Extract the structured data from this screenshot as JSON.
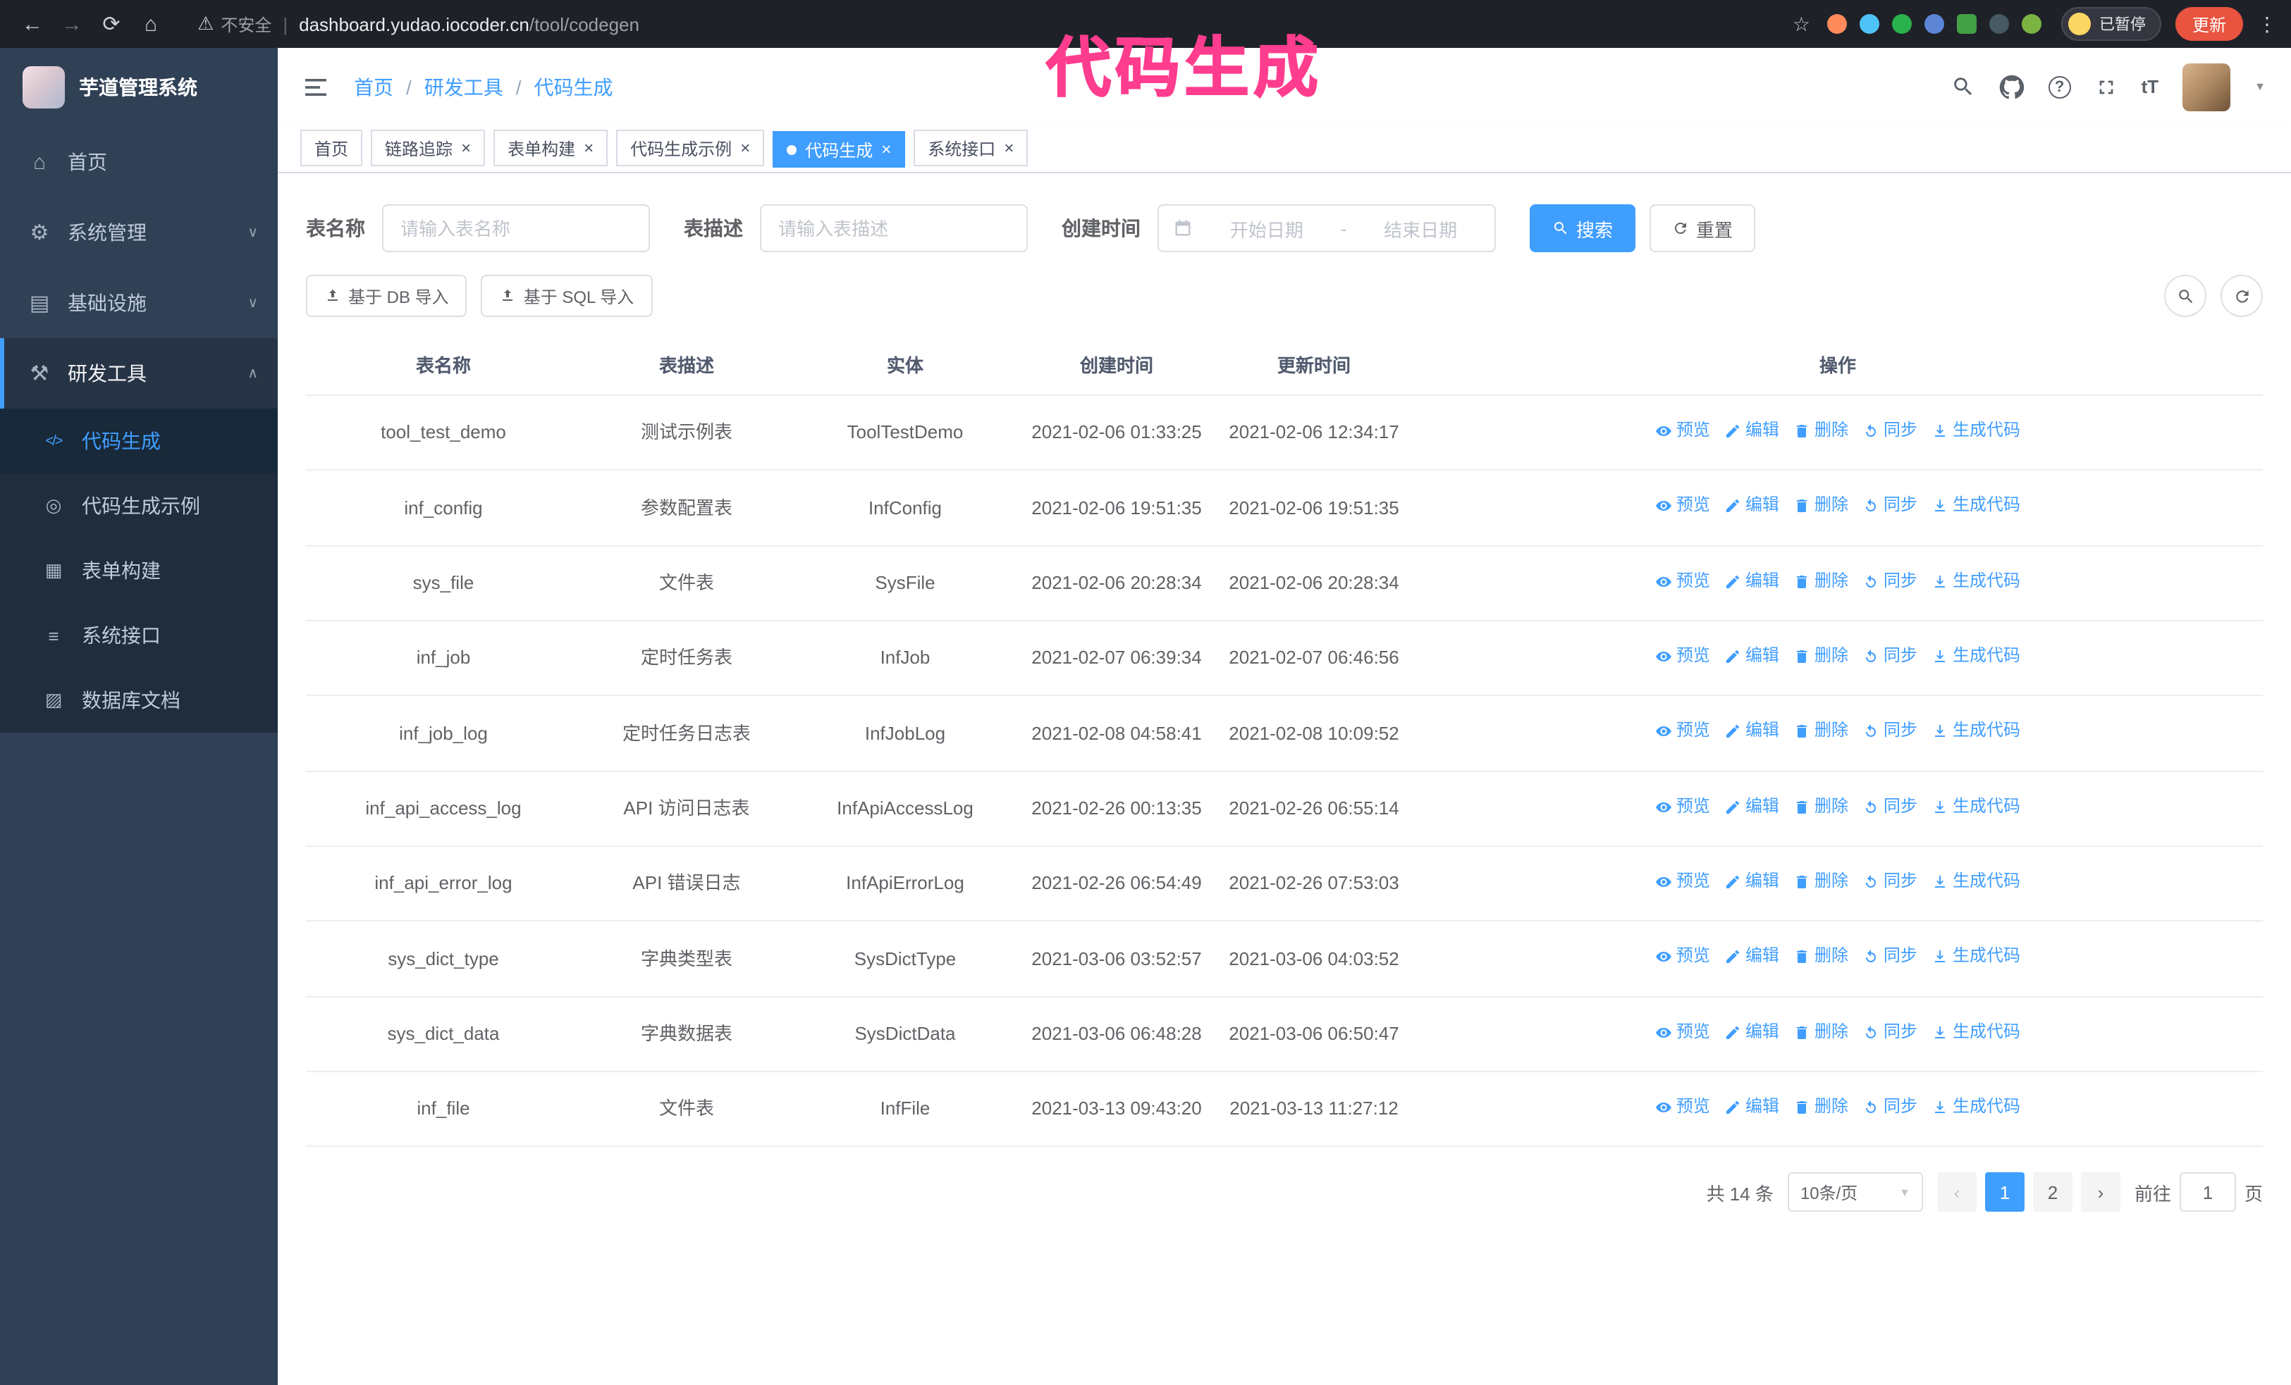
{
  "annotation": {
    "text": "代码生成",
    "color": "#ff3d8e"
  },
  "browser": {
    "security_text": "不安全",
    "url_host": "dashboard.yudao.iocoder.cn",
    "url_path": "/tool/codegen",
    "paused_label": "已暂停",
    "update_label": "更新",
    "extensions": [
      {
        "name": "extension-icon",
        "color": "#ff8a5c",
        "shape": "circle"
      },
      {
        "name": "extension-icon",
        "color": "#4fc3f7",
        "shape": "circle"
      },
      {
        "name": "extension-icon",
        "color": "#2bb24c",
        "shape": "circle"
      },
      {
        "name": "extension-icon",
        "color": "#5c85d6",
        "shape": "circle"
      },
      {
        "name": "extension-icon",
        "color": "#43a047",
        "shape": "square"
      },
      {
        "name": "extension-icon",
        "color": "#455a64",
        "shape": "circle"
      },
      {
        "name": "extension-icon",
        "color": "#7cb342",
        "shape": "circle"
      }
    ]
  },
  "sidebar": {
    "logo_title": "芋道管理系统",
    "items": [
      {
        "key": "home",
        "label": "首页",
        "icon": "home-icon"
      },
      {
        "key": "system",
        "label": "系统管理",
        "icon": "system-icon",
        "chevron": "down"
      },
      {
        "key": "infra",
        "label": "基础设施",
        "icon": "infra-icon",
        "chevron": "down"
      },
      {
        "key": "devtools",
        "label": "研发工具",
        "icon": "devtools-icon",
        "chevron": "up",
        "expanded": true
      }
    ],
    "sub_items": [
      {
        "key": "codegen",
        "label": "代码生成",
        "icon": "codegen-icon",
        "active": true
      },
      {
        "key": "codegen-example",
        "label": "代码生成示例",
        "icon": "example-icon"
      },
      {
        "key": "form-builder",
        "label": "表单构建",
        "icon": "form-icon"
      },
      {
        "key": "api",
        "label": "系统接口",
        "icon": "api-icon"
      },
      {
        "key": "db-doc",
        "label": "数据库文档",
        "icon": "dbdoc-icon"
      }
    ]
  },
  "header": {
    "breadcrumb": [
      "首页",
      "研发工具",
      "代码生成"
    ]
  },
  "tabs": [
    {
      "key": "home",
      "label": "首页",
      "closable": false
    },
    {
      "key": "tracing",
      "label": "链路追踪",
      "closable": true
    },
    {
      "key": "form-builder",
      "label": "表单构建",
      "closable": true
    },
    {
      "key": "codegen-example",
      "label": "代码生成示例",
      "closable": true
    },
    {
      "key": "codegen",
      "label": "代码生成",
      "closable": true,
      "active": true
    },
    {
      "key": "api",
      "label": "系统接口",
      "closable": true
    }
  ],
  "filters": {
    "table_name_label": "表名称",
    "table_name_placeholder": "请输入表名称",
    "table_desc_label": "表描述",
    "table_desc_placeholder": "请输入表描述",
    "create_time_label": "创建时间",
    "start_date_placeholder": "开始日期",
    "range_separator": "-",
    "end_date_placeholder": "结束日期",
    "search_label": "搜索",
    "reset_label": "重置"
  },
  "toolbar": {
    "import_db_label": "基于 DB 导入",
    "import_sql_label": "基于 SQL 导入"
  },
  "table": {
    "columns": [
      "表名称",
      "表描述",
      "实体",
      "创建时间",
      "更新时间",
      "操作"
    ],
    "actions": [
      "预览",
      "编辑",
      "删除",
      "同步",
      "生成代码"
    ],
    "rows": [
      {
        "name": "tool_test_demo",
        "desc": "测试示例表",
        "entity": "ToolTestDemo",
        "created": "2021-02-06 01:33:25",
        "updated": "2021-02-06 12:34:17"
      },
      {
        "name": "inf_config",
        "desc": "参数配置表",
        "entity": "InfConfig",
        "created": "2021-02-06 19:51:35",
        "updated": "2021-02-06 19:51:35"
      },
      {
        "name": "sys_file",
        "desc": "文件表",
        "entity": "SysFile",
        "created": "2021-02-06 20:28:34",
        "updated": "2021-02-06 20:28:34"
      },
      {
        "name": "inf_job",
        "desc": "定时任务表",
        "entity": "InfJob",
        "created": "2021-02-07 06:39:34",
        "updated": "2021-02-07 06:46:56"
      },
      {
        "name": "inf_job_log",
        "desc": "定时任务日志表",
        "entity": "InfJobLog",
        "created": "2021-02-08 04:58:41",
        "updated": "2021-02-08 10:09:52"
      },
      {
        "name": "inf_api_access_log",
        "desc": "API 访问日志表",
        "entity": "InfApiAccessLog",
        "created": "2021-02-26 00:13:35",
        "updated": "2021-02-26 06:55:14"
      },
      {
        "name": "inf_api_error_log",
        "desc": "API 错误日志",
        "entity": "InfApiErrorLog",
        "created": "2021-02-26 06:54:49",
        "updated": "2021-02-26 07:53:03"
      },
      {
        "name": "sys_dict_type",
        "desc": "字典类型表",
        "entity": "SysDictType",
        "created": "2021-03-06 03:52:57",
        "updated": "2021-03-06 04:03:52"
      },
      {
        "name": "sys_dict_data",
        "desc": "字典数据表",
        "entity": "SysDictData",
        "created": "2021-03-06 06:48:28",
        "updated": "2021-03-06 06:50:47"
      },
      {
        "name": "inf_file",
        "desc": "文件表",
        "entity": "InfFile",
        "created": "2021-03-13 09:43:20",
        "updated": "2021-03-13 11:27:12"
      }
    ]
  },
  "pagination": {
    "total_text": "共 14 条",
    "page_size": "10条/页",
    "pages": [
      "1",
      "2"
    ],
    "current_page": "1",
    "goto_prefix": "前往",
    "goto_value": "1",
    "goto_suffix": "页"
  },
  "colors": {
    "accent": "#409eff",
    "annotation": "#ff3d8e",
    "sidebar_bg": "#304156",
    "submenu_bg": "#1f2d3d",
    "chrome_bg": "#1f2128",
    "update_button": "#e8543f"
  }
}
